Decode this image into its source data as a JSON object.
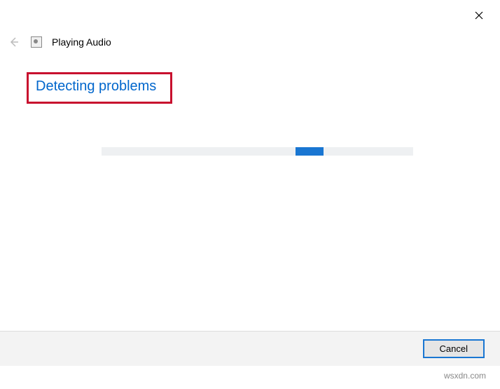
{
  "header": {
    "title": "Playing Audio"
  },
  "main": {
    "heading": "Detecting problems"
  },
  "footer": {
    "cancel_label": "Cancel"
  },
  "watermark": "wsxdn.com"
}
